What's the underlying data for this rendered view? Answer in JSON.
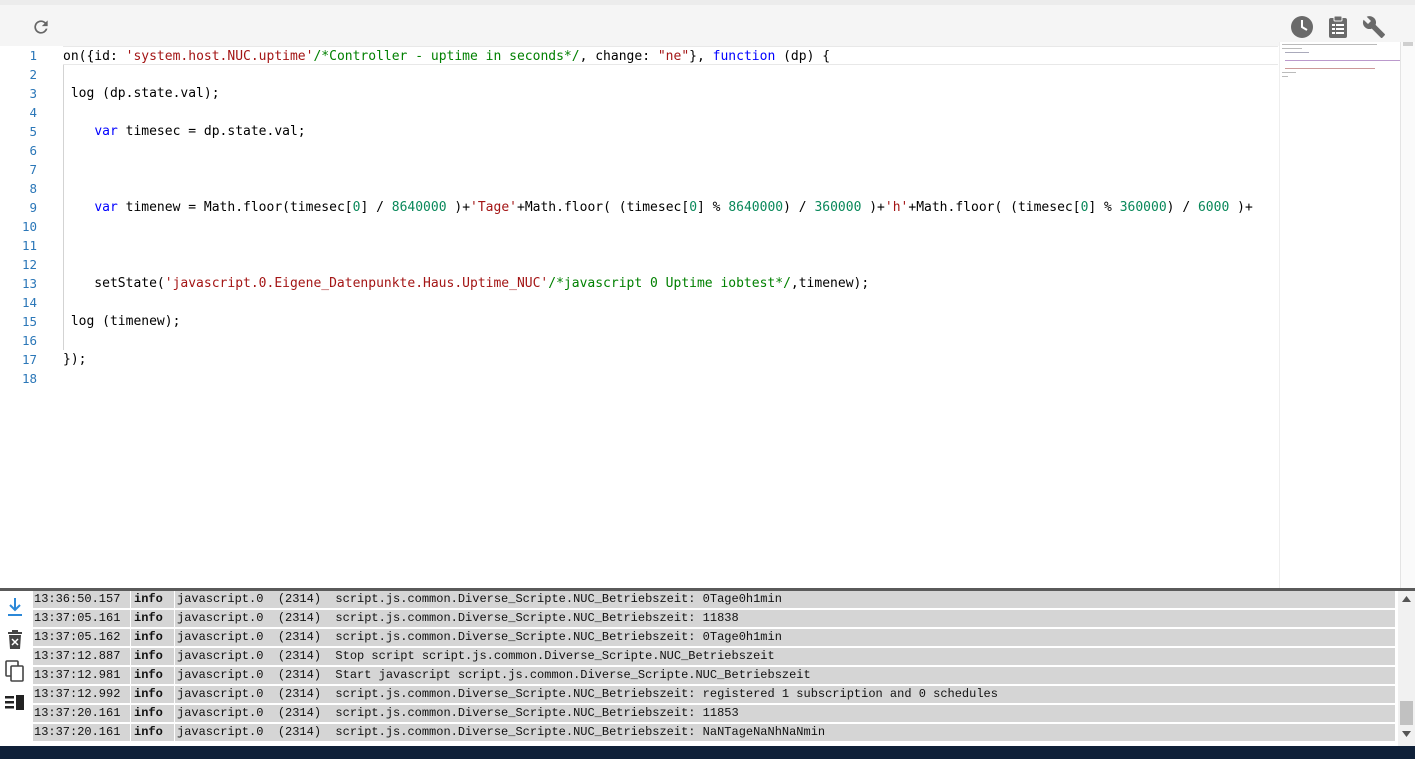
{
  "toolbar": {
    "left_icons": [
      {
        "name": "refresh-icon"
      }
    ],
    "right_icons": [
      {
        "name": "clock-icon"
      },
      {
        "name": "clipboard-icon"
      },
      {
        "name": "wrench-icon"
      }
    ]
  },
  "editor": {
    "line_numbers": [
      "1",
      "2",
      "3",
      "4",
      "5",
      "6",
      "7",
      "8",
      "9",
      "10",
      "11",
      "12",
      "13",
      "14",
      "15",
      "16",
      "17",
      "18"
    ],
    "colors": {
      "keyword": "#0000ff",
      "string": "#a31515",
      "comment": "#008000",
      "number": "#09885a",
      "line_number": "#2b77b8"
    }
  },
  "log": {
    "side_icons": [
      {
        "name": "scroll-down-icon"
      },
      {
        "name": "clear-log-icon"
      },
      {
        "name": "copy-icon"
      },
      {
        "name": "filter-icon"
      }
    ],
    "rows": [
      {
        "time": "13:36:50.157",
        "level": "info",
        "msg": "javascript.0  (2314)  script.js.common.Diverse_Scripte.NUC_Betriebszeit: 0Tage0h1min"
      },
      {
        "time": "13:37:05.161",
        "level": "info",
        "msg": "javascript.0  (2314)  script.js.common.Diverse_Scripte.NUC_Betriebszeit: 11838"
      },
      {
        "time": "13:37:05.162",
        "level": "info",
        "msg": "javascript.0  (2314)  script.js.common.Diverse_Scripte.NUC_Betriebszeit: 0Tage0h1min"
      },
      {
        "time": "13:37:12.887",
        "level": "info",
        "msg": "javascript.0  (2314)  Stop script script.js.common.Diverse_Scripte.NUC_Betriebszeit"
      },
      {
        "time": "13:37:12.981",
        "level": "info",
        "msg": "javascript.0  (2314)  Start javascript script.js.common.Diverse_Scripte.NUC_Betriebszeit"
      },
      {
        "time": "13:37:12.992",
        "level": "info",
        "msg": "javascript.0  (2314)  script.js.common.Diverse_Scripte.NUC_Betriebszeit: registered 1 subscription and 0 schedules"
      },
      {
        "time": "13:37:20.161",
        "level": "info",
        "msg": "javascript.0  (2314)  script.js.common.Diverse_Scripte.NUC_Betriebszeit: 11853"
      },
      {
        "time": "13:37:20.161",
        "level": "info",
        "msg": "javascript.0  (2314)  script.js.common.Diverse_Scripte.NUC_Betriebszeit: NaNTageNaNhNaNmin"
      }
    ]
  }
}
